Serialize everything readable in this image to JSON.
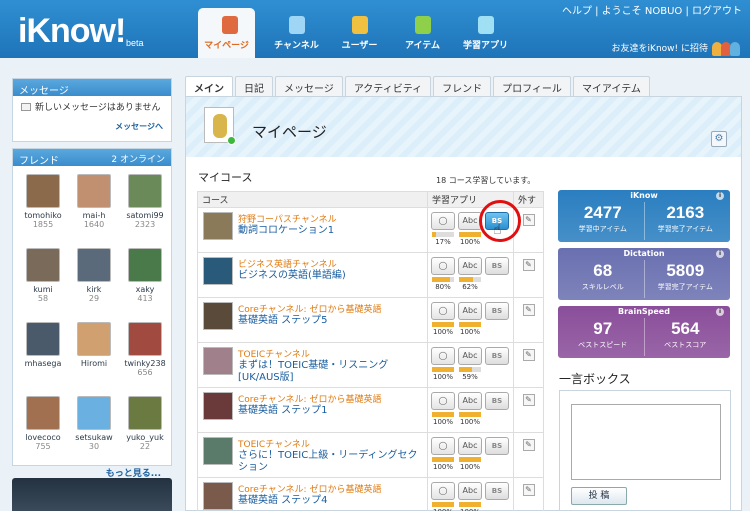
{
  "app": {
    "logo": "iKnow!",
    "logo_sub": "beta"
  },
  "top_links": "ヘルプ | ようこそ NOBUO | ログアウト",
  "invite_text": "お友達をiKnow! に招待",
  "nav": [
    {
      "label": "マイページ",
      "icon": "mypage-icon",
      "active": true,
      "color": "#e06a40"
    },
    {
      "label": "チャンネル",
      "icon": "tv-icon",
      "active": false,
      "color": "#9fd5f5"
    },
    {
      "label": "ユーザー",
      "icon": "users-icon",
      "active": false,
      "color": "#f0c040"
    },
    {
      "label": "アイテム",
      "icon": "list-icon",
      "active": false,
      "color": "#8fd04a"
    },
    {
      "label": "学習アプリ",
      "icon": "app-icon",
      "active": false,
      "color": "#9fe0f5"
    }
  ],
  "message_panel": {
    "title": "メッセージ",
    "text": "新しいメッセージはありません",
    "link": "メッセージへ"
  },
  "friends_panel": {
    "title": "フレンド",
    "online": "2 オンライン",
    "friends": [
      {
        "name": "tomohiko",
        "count": "1855",
        "color": "#8a6a4a"
      },
      {
        "name": "mai-h",
        "count": "1640",
        "color": "#c09070"
      },
      {
        "name": "satomi99",
        "count": "2323",
        "color": "#6a8a5a"
      },
      {
        "name": "kumi",
        "count": "58",
        "color": "#7a6a5a"
      },
      {
        "name": "kirk",
        "count": "29",
        "color": "#5a6a7a"
      },
      {
        "name": "xaky",
        "count": "413",
        "color": "#4a7a4a"
      },
      {
        "name": "mhasega",
        "count": "",
        "color": "#4a5a6a"
      },
      {
        "name": "Hiromi",
        "count": "",
        "color": "#d0a070"
      },
      {
        "name": "twinky238",
        "count": "656",
        "color": "#a04a40"
      },
      {
        "name": "lovecoco",
        "count": "755",
        "color": "#a07050"
      },
      {
        "name": "setsukaw",
        "count": "30",
        "color": "#6ab0e0"
      },
      {
        "name": "yuko_yuk",
        "count": "22",
        "color": "#6a7a40"
      }
    ],
    "more": "もっと見る..."
  },
  "tabs": [
    "メイン",
    "日記",
    "メッセージ",
    "アクティビティ",
    "フレンド",
    "プロフィール",
    "マイアイテム"
  ],
  "page": {
    "title": "マイページ"
  },
  "courses": {
    "section_title": "マイコース",
    "count_text": "18 コース学習しています。",
    "headers": {
      "course": "コース",
      "apps": "学習アプリ",
      "remove": "外す"
    },
    "rows": [
      {
        "channel": "狩野コーパスチャンネル",
        "name": "動詞コロケーション1",
        "p1": "17%",
        "p1v": 0.17,
        "p2": "100%",
        "p2v": 1.0,
        "bs_active": true,
        "color": "#8a7a5a"
      },
      {
        "channel": "ビジネス英語チャンネル",
        "name": "ビジネスの英語(単語編)",
        "p1": "80%",
        "p1v": 0.8,
        "p2": "62%",
        "p2v": 0.62,
        "bs_active": false,
        "color": "#2a5a7a"
      },
      {
        "channel": "Coreチャンネル: ゼロから基礎英語",
        "name": "基礎英語 ステップ5",
        "p1": "100%",
        "p1v": 1.0,
        "p2": "100%",
        "p2v": 1.0,
        "bs_active": false,
        "color": "#5a4a3a"
      },
      {
        "channel": "TOEICチャンネル",
        "name": "まずは！TOEIC基礎・リスニング[UK/AUS版]",
        "p1": "100%",
        "p1v": 1.0,
        "p2": "59%",
        "p2v": 0.59,
        "bs_active": false,
        "color": "#a0808a"
      },
      {
        "channel": "Coreチャンネル: ゼロから基礎英語",
        "name": "基礎英語 ステップ1",
        "p1": "100%",
        "p1v": 1.0,
        "p2": "100%",
        "p2v": 1.0,
        "bs_active": false,
        "color": "#6a3a3a"
      },
      {
        "channel": "TOEICチャンネル",
        "name": "さらに！TOEIC上級・リーディングセクション",
        "p1": "100%",
        "p1v": 1.0,
        "p2": "100%",
        "p2v": 1.0,
        "bs_active": false,
        "color": "#5a7a6a"
      },
      {
        "channel": "Coreチャンネル: ゼロから基礎英語",
        "name": "基礎英語 ステップ4",
        "p1": "100%",
        "p1v": 1.0,
        "p2": "100%",
        "p2v": 1.0,
        "bs_active": false,
        "color": "#7a5a4a"
      }
    ]
  },
  "stats": [
    {
      "title": "iKnow",
      "color": "#2a7ec0",
      "a_num": "2477",
      "a_lbl": "学習中アイテム",
      "b_num": "2163",
      "b_lbl": "学習完了アイテム"
    },
    {
      "title": "Dictation",
      "color": "#6a70b0",
      "a_num": "68",
      "a_lbl": "スキルレベル",
      "b_num": "5809",
      "b_lbl": "学習完了アイテム"
    },
    {
      "title": "BrainSpeed",
      "color": "#8a4e9a",
      "a_num": "97",
      "a_lbl": "ベストスピード",
      "b_num": "564",
      "b_lbl": "ベストスコア"
    }
  ],
  "shoutbox": {
    "title": "一言ボックス",
    "button": "投 稿"
  }
}
